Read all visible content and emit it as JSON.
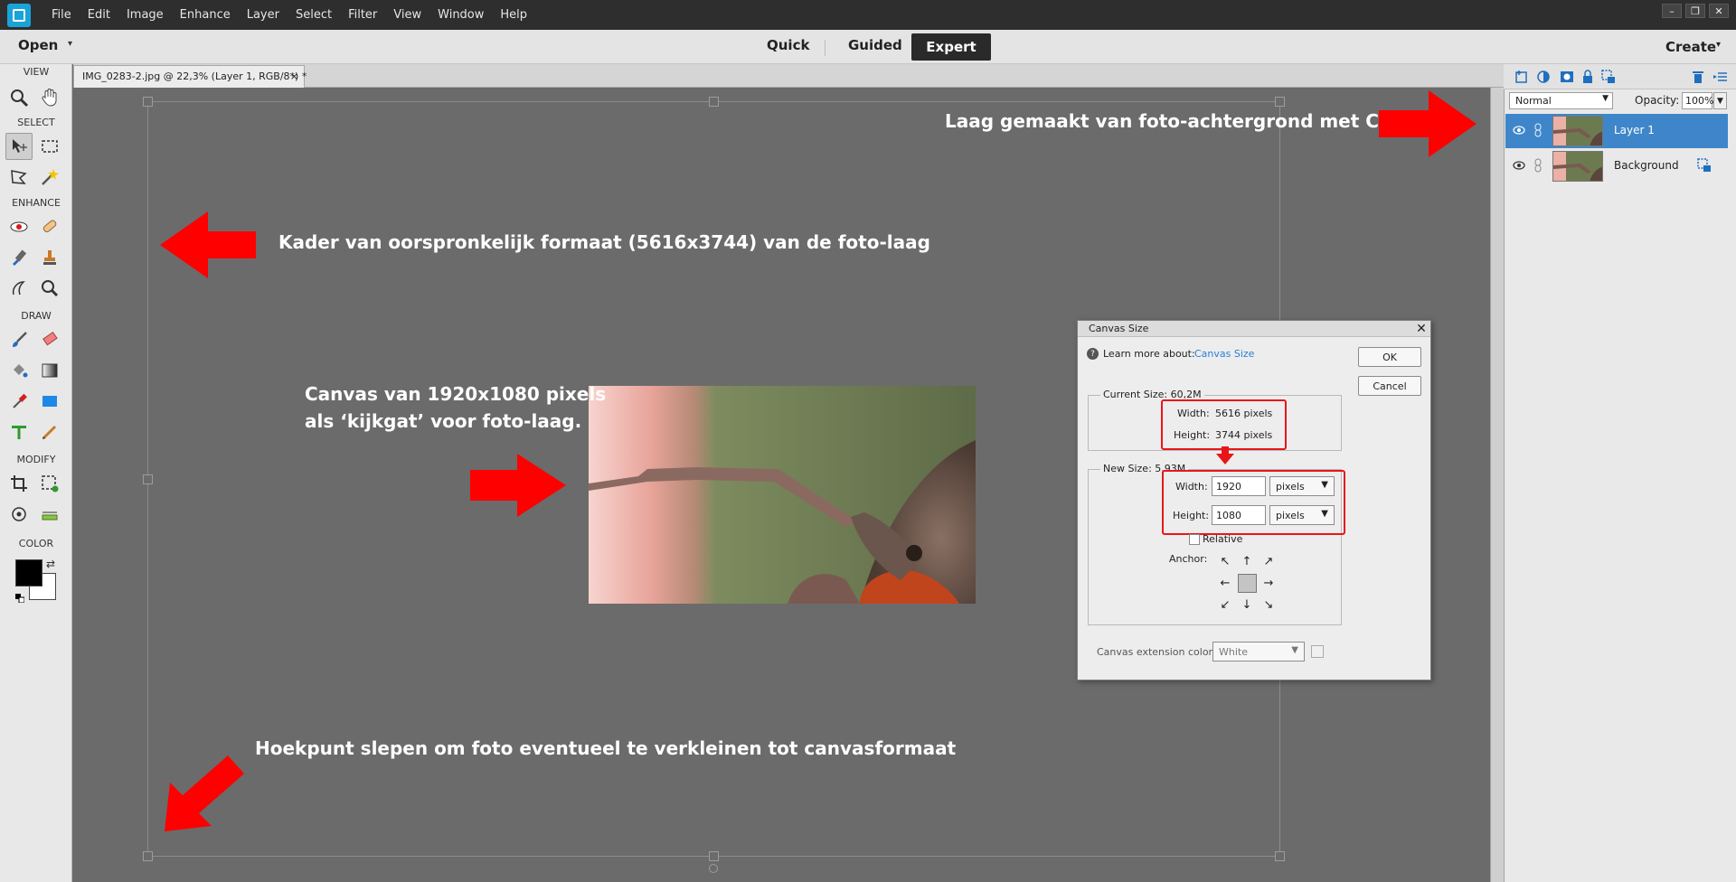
{
  "menubar": {
    "items": [
      "File",
      "Edit",
      "Image",
      "Enhance",
      "Layer",
      "Select",
      "Filter",
      "View",
      "Window",
      "Help"
    ]
  },
  "modebar": {
    "open": "Open",
    "quick": "Quick",
    "guided": "Guided",
    "expert": "Expert",
    "create": "Create"
  },
  "toolbar": {
    "sections": [
      "VIEW",
      "SELECT",
      "ENHANCE",
      "DRAW",
      "MODIFY",
      "COLOR"
    ],
    "foreground_color": "#000000",
    "background_color": "#ffffff"
  },
  "document": {
    "tab_title": "IMG_0283-2.jpg @ 22,3% (Layer 1, RGB/8*) *",
    "close": "×"
  },
  "annotations": {
    "layer_note": "Laag gemaakt van foto-achtergrond met Ctrl-J",
    "frame_note": "Kader van oorspronkelijk formaat (5616x3744) van de foto-laag",
    "canvas_note_line1": "Canvas van 1920x1080 pixels",
    "canvas_note_line2": "als ‘kijkgat’ voor foto-laag.",
    "corner_note": "Hoekpunt slepen om foto eventueel te verkleinen tot canvasformaat",
    "arrow_color": "#ff0000"
  },
  "layers_panel": {
    "blend_mode": "Normal",
    "opacity_label": "Opacity:",
    "opacity_value": "100%",
    "layers": [
      {
        "name": "Layer 1",
        "active": true
      },
      {
        "name": "Background",
        "active": false
      }
    ],
    "active_color": "#3e86c9"
  },
  "dialog": {
    "title": "Canvas Size",
    "learn_more": "Learn more about:",
    "learn_more_link": "Canvas Size",
    "ok": "OK",
    "cancel": "Cancel",
    "current_size_label": "Current Size: 60,2M",
    "current_width_label": "Width:",
    "current_width_value": "5616 pixels",
    "current_height_label": "Height:",
    "current_height_value": "3744 pixels",
    "new_size_label": "New Size: 5,93M",
    "new_width_label": "Width:",
    "new_width_value": "1920",
    "new_width_unit": "pixels",
    "new_height_label": "Height:",
    "new_height_value": "1080",
    "new_height_unit": "pixels",
    "relative_label": "Relative",
    "anchor_label": "Anchor:",
    "extension_color_label": "Canvas extension color:",
    "extension_color_value": "White",
    "highlight_color": "#e8161a",
    "link_color": "#2a7fd4"
  }
}
